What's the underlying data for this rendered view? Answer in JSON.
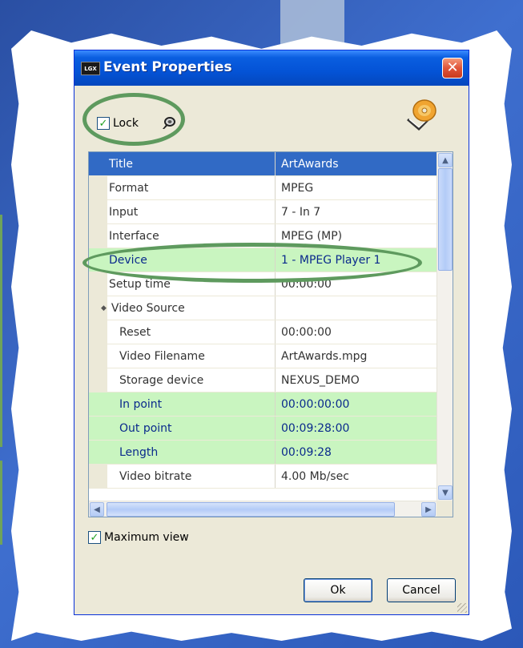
{
  "window": {
    "title": "Event Properties",
    "logo_text": "LGX",
    "close_symbol": "✕"
  },
  "lock": {
    "label": "Lock",
    "checked": true,
    "pin_icon": "pin-icon"
  },
  "properties": [
    {
      "name": "Title",
      "value": "ArtAwards",
      "state": "selected"
    },
    {
      "name": "Format",
      "value": "MPEG"
    },
    {
      "name": "Input",
      "value": "7 - In 7"
    },
    {
      "name": "Interface",
      "value": "MPEG (MP)"
    },
    {
      "name": "Device",
      "value": "1 - MPEG Player 1",
      "state": "highlighted"
    },
    {
      "name": "Setup time",
      "value": "00:00:00"
    },
    {
      "name": "Video Source",
      "value": "",
      "group": true
    },
    {
      "name": "Reset",
      "value": "00:00:00",
      "indent": true
    },
    {
      "name": "Video Filename",
      "value": "ArtAwards.mpg",
      "indent": true
    },
    {
      "name": "Storage device",
      "value": "NEXUS_DEMO",
      "indent": true
    },
    {
      "name": "In point",
      "value": "00:00:00:00",
      "indent": true,
      "state": "highlighted"
    },
    {
      "name": "Out point",
      "value": "00:09:28:00",
      "indent": true,
      "state": "highlighted"
    },
    {
      "name": "Length",
      "value": "00:09:28",
      "indent": true,
      "state": "highlighted"
    },
    {
      "name": "Video bitrate",
      "value": "4.00 Mb/sec",
      "indent": true
    }
  ],
  "scrollbars": {
    "up": "▲",
    "down": "▼",
    "left": "◀",
    "right": "▶"
  },
  "maximum_view": {
    "label": "Maximum view",
    "checked": true
  },
  "buttons": {
    "ok": "Ok",
    "cancel": "Cancel"
  },
  "colors": {
    "selection": "#316ac5",
    "highlight": "#c9f5c0",
    "annotation_ring": "#5e9a5e",
    "titlebar": "#0453d6"
  }
}
